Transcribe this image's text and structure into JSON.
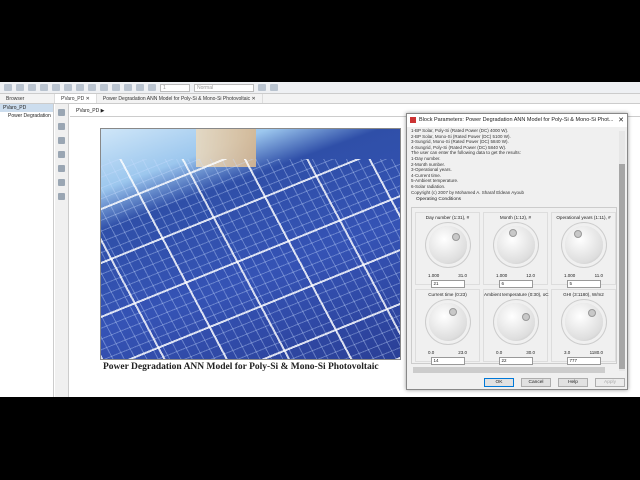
{
  "toolbar": {
    "zoom_field": "1",
    "mode_select": "Normal"
  },
  "tabs": [
    {
      "label": "PVaro_PD",
      "close": "✕"
    },
    {
      "label": "Power Degradation ANN Model for Poly-Si & Mono-Si Photovoltaic",
      "close": "✕"
    }
  ],
  "browser": {
    "title": "Browser",
    "items": [
      "PVaro_PD",
      "Power Degradation"
    ]
  },
  "breadcrumb": "PVaro_PD ▶",
  "canvas": {
    "caption": "Power Degradation ANN Model for Poly-Si & Mono-Si Photovoltaic"
  },
  "dialog": {
    "title": "Block Parameters: Power Degradation ANN Model for Poly-Si & Mono-Si Phot...",
    "close": "✕",
    "description": [
      "1-BP Solar, Poly-Si (Rated Power (DC) 4000 W).",
      "2-BP Solar, Mono-Si (Rated Power (DC) 5100 W).",
      "3-Sungrid, Mono-Si (Rated Power (DC) 5840 W).",
      "4-Sungrid, Poly-Si (Rated Power (DC) 5840 W).",
      "The user can enter the following data to get the results:",
      "1-Day number.",
      "2-Month number.",
      "3-Operational years.",
      "4-Current time.",
      "5-Ambient temperature.",
      "6-Solar radiation.",
      "Copyright (c) 2007 by Mohamed A. Sharaf Eldean Ayoub"
    ],
    "group_label": "Operating Conditions",
    "knobs": [
      {
        "label": "Day number (1:31), #",
        "min": "1.000",
        "max": "31.0",
        "value": "21",
        "minv": 1,
        "maxv": 31,
        "v": 21
      },
      {
        "label": "Month (1:12), #",
        "min": "1.000",
        "max": "12.0",
        "value": "6",
        "minv": 1,
        "maxv": 12,
        "v": 6
      },
      {
        "label": "Operational years (1:11), #",
        "min": "1.000",
        "max": "11.0",
        "value": "5",
        "minv": 1,
        "maxv": 11,
        "v": 5
      },
      {
        "label": "Current time (0:23)",
        "min": "0.0",
        "max": "23.0",
        "value": "14",
        "minv": 0,
        "maxv": 23,
        "v": 14
      },
      {
        "label": "Ambient temperature (0:30), oC",
        "min": "0.0",
        "max": "30.0",
        "value": "22",
        "minv": 0,
        "maxv": 30,
        "v": 22
      },
      {
        "label": "GHI (3:1180), W/m2",
        "min": "3.0",
        "max": "1180.0",
        "value": "777",
        "minv": 3,
        "maxv": 1180,
        "v": 777
      }
    ],
    "buttons": {
      "ok": "OK",
      "cancel": "Cancel",
      "help": "Help",
      "apply": "Apply"
    }
  }
}
